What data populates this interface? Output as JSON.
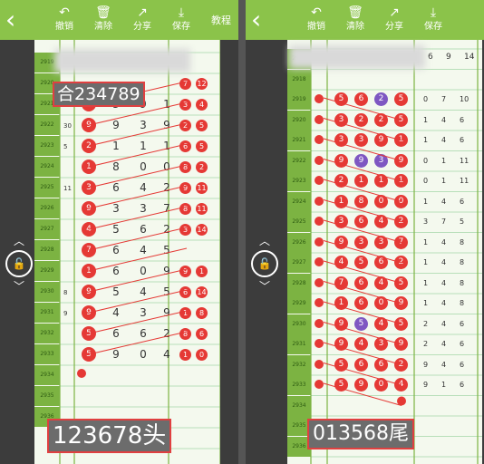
{
  "toolbar": {
    "undo_label": "撤销",
    "clear_label": "清除",
    "share_label": "分享",
    "save_label": "保存",
    "tutorial_label": "教程"
  },
  "left": {
    "label_top": "合234789",
    "label_bottom": "123678头",
    "row_labels": [
      "2919",
      "2920",
      "2921",
      "2922",
      "2923",
      "2924",
      "2925",
      "2926",
      "2927",
      "2928",
      "2929",
      "2930",
      "2931",
      "2932",
      "2933",
      "2934",
      "2935",
      "2936"
    ],
    "side_numbers": [
      "",
      "",
      "",
      "30",
      "5",
      "",
      "11",
      "",
      "",
      "",
      "",
      "8",
      "9",
      "",
      "",
      "",
      "",
      ""
    ],
    "cells": [
      [
        "3",
        "3",
        "9",
        "1"
      ],
      [
        "9",
        "9",
        "3",
        "9"
      ],
      [
        "2",
        "1",
        "1",
        "1"
      ],
      [
        "1",
        "8",
        "0",
        "0"
      ],
      [
        "3",
        "6",
        "4",
        "2"
      ],
      [
        "9",
        "3",
        "3",
        "7"
      ],
      [
        "4",
        "5",
        "6",
        "2"
      ],
      [
        "7",
        "6",
        "4",
        "5"
      ],
      [
        "1",
        "6",
        "0",
        "9"
      ],
      [
        "9",
        "5",
        "4",
        "5"
      ],
      [
        "9",
        "4",
        "3",
        "9"
      ],
      [
        "5",
        "6",
        "6",
        "2"
      ],
      [
        "5",
        "9",
        "0",
        "4"
      ]
    ],
    "right_pairs": [
      [
        "7",
        "12"
      ],
      [
        "3",
        "4"
      ],
      [
        "2",
        "5"
      ],
      [
        "6",
        "5"
      ],
      [
        "8",
        "2"
      ],
      [
        "9",
        "11"
      ],
      [
        "8",
        "11"
      ],
      [
        "3",
        "14"
      ],
      [
        "",
        ""
      ],
      [
        "9",
        "1"
      ],
      [
        "6",
        "14"
      ],
      [
        "1",
        "8"
      ],
      [
        "8",
        "6"
      ],
      [
        "1",
        "0"
      ]
    ]
  },
  "right": {
    "label_bottom": "013568尾",
    "row_labels": [
      "2917",
      "2918",
      "2919",
      "2920",
      "2921",
      "2922",
      "2923",
      "2924",
      "2925",
      "2926",
      "2927",
      "2928",
      "2929",
      "2930",
      "2931",
      "2932",
      "2933",
      "2934",
      "2935",
      "2936"
    ],
    "cells": [
      [
        "5",
        "6",
        "2",
        "5"
      ],
      [
        "3",
        "2",
        "2",
        "5"
      ],
      [
        "3",
        "3",
        "9",
        "1"
      ],
      [
        "9",
        "9",
        "3",
        "9"
      ],
      [
        "2",
        "1",
        "1",
        "1"
      ],
      [
        "1",
        "8",
        "0",
        "0"
      ],
      [
        "3",
        "6",
        "4",
        "2"
      ],
      [
        "9",
        "3",
        "3",
        "7"
      ],
      [
        "4",
        "5",
        "6",
        "2"
      ],
      [
        "7",
        "6",
        "4",
        "5"
      ],
      [
        "1",
        "6",
        "0",
        "9"
      ],
      [
        "9",
        "5",
        "4",
        "5"
      ],
      [
        "9",
        "4",
        "3",
        "9"
      ],
      [
        "5",
        "6",
        "6",
        "2"
      ],
      [
        "5",
        "9",
        "0",
        "4"
      ]
    ],
    "right_numbers": [
      [
        "0",
        "7",
        "10"
      ],
      [
        "1",
        "4",
        "6"
      ],
      [
        "1",
        "4",
        "6"
      ],
      [
        "0",
        "1",
        "11"
      ],
      [
        "0",
        "1",
        "11"
      ],
      [
        "1",
        "4",
        "6"
      ],
      [
        "3",
        "7",
        "5"
      ],
      [
        "1",
        "4",
        "8"
      ],
      [
        "1",
        "4",
        "8"
      ],
      [
        "1",
        "4",
        "8"
      ],
      [
        "1",
        "4",
        "8"
      ],
      [
        "2",
        "4",
        "6"
      ],
      [
        "2",
        "4",
        "6"
      ],
      [
        "9",
        "4",
        "6"
      ],
      [
        "9",
        "1",
        "6"
      ]
    ],
    "top_numbers": [
      "6",
      "9",
      "14"
    ]
  },
  "colors": {
    "accent": "#8bc34a",
    "red": "#e53935",
    "purple": "#7e57c2"
  }
}
